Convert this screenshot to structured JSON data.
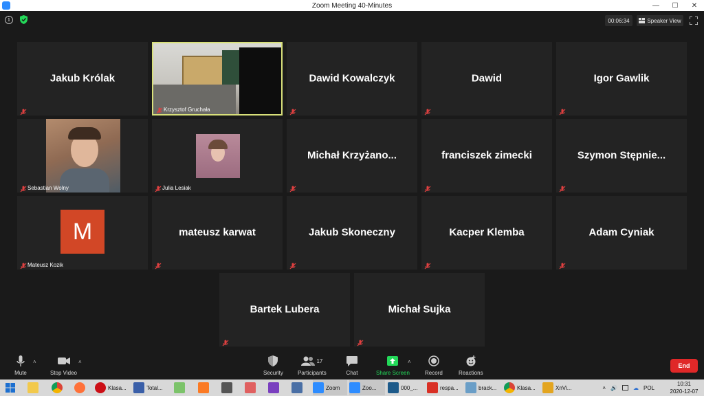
{
  "window": {
    "title": "Zoom Meeting 40-Minutes"
  },
  "topbar": {
    "timer": "00:06:34",
    "view_label": "Speaker View"
  },
  "participants": [
    {
      "name": "Jakub Królak",
      "label": ""
    },
    {
      "name": "",
      "label": "Krzysztof Gruchała"
    },
    {
      "name": "Dawid Kowalczyk",
      "label": ""
    },
    {
      "name": "Dawid",
      "label": ""
    },
    {
      "name": "Igor Gawlik",
      "label": ""
    },
    {
      "name": "",
      "label": "Sebastian Wolny"
    },
    {
      "name": "",
      "label": "Julia Lesiak"
    },
    {
      "name": "Michał  Krzyżano...",
      "label": ""
    },
    {
      "name": "franciszek zimecki",
      "label": ""
    },
    {
      "name": "Szymon  Stępnie...",
      "label": ""
    },
    {
      "name": "",
      "label": "Mateusz Kozik",
      "avatar_letter": "M"
    },
    {
      "name": "mateusz karwat",
      "label": ""
    },
    {
      "name": "Jakub Skoneczny",
      "label": ""
    },
    {
      "name": "Kacper Klemba",
      "label": ""
    },
    {
      "name": "Adam Cyniak",
      "label": ""
    },
    {
      "name": "Bartek Lubera",
      "label": ""
    },
    {
      "name": "Michał Sujka",
      "label": ""
    }
  ],
  "toolbar": {
    "mute": "Mute",
    "stop_video": "Stop Video",
    "security": "Security",
    "participants": "Participants",
    "participants_count": "17",
    "chat": "Chat",
    "share_screen": "Share Screen",
    "record": "Record",
    "reactions": "Reactions",
    "end": "End"
  },
  "taskbar": {
    "items": [
      "Klasa...",
      "Total...",
      "Zoom",
      "Zoo...",
      "000_...",
      "respa...",
      "brack...",
      "Klasa...",
      "XnVi..."
    ],
    "language": "POL",
    "time": "10:31",
    "date": "2020-12-07"
  },
  "colors": {
    "tile_bg": "#232323",
    "active_speaker_border": "#d8e07a",
    "end_button": "#e02828",
    "share_green": "#23d959",
    "avatar_orange": "#d24726"
  }
}
